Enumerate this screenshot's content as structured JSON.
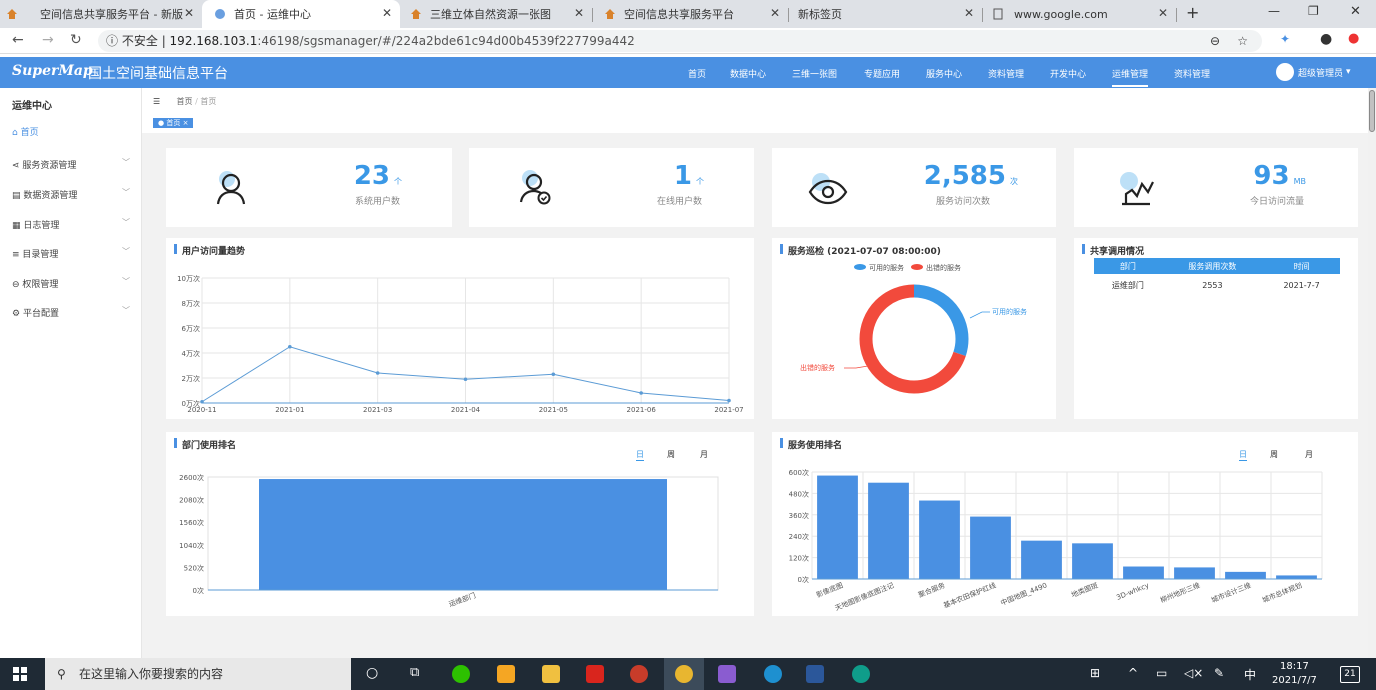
{
  "browser": {
    "tabs": [
      {
        "title": "空间信息共享服务平台 - 新版"
      },
      {
        "title": "首页 - 运维中心"
      },
      {
        "title": "三维立体自然资源一张图"
      },
      {
        "title": "空间信息共享服务平台"
      },
      {
        "title": "新标签页"
      },
      {
        "title": "www.google.com"
      }
    ],
    "new_tab": "+",
    "address": {
      "security": "不安全",
      "host": "192.168.103.1",
      "path": ":46198/sgsmanager/#/224a2bde61c94d00b4539f227799a442"
    }
  },
  "app": {
    "logo": "SuperMap",
    "title": "国土空间基础信息平台",
    "nav": [
      "首页",
      "数据中心",
      "三维一张图",
      "专题应用",
      "服务中心",
      "资料管理",
      "开发中心",
      "运维管理",
      "资料管理"
    ],
    "active_nav": "运维管理",
    "user": "超级管理员"
  },
  "sidebar": {
    "title": "运维中心",
    "home": "首页",
    "items": [
      "服务资源管理",
      "数据资源管理",
      "日志管理",
      "目录管理",
      "权限管理",
      "平台配置"
    ]
  },
  "breadcrumb": {
    "home": "首页",
    "sep": "/",
    "current": "首页"
  },
  "page_tab": "首页",
  "stats": [
    {
      "value": "23",
      "unit": "个",
      "label": "系统用户数",
      "icon": "user-icon"
    },
    {
      "value": "1",
      "unit": "个",
      "label": "在线用户数",
      "icon": "online-user-icon"
    },
    {
      "value": "2,585",
      "unit": "次",
      "label": "服务访问次数",
      "icon": "eye-icon"
    },
    {
      "value": "93",
      "unit": "MB",
      "label": "今日访问流量",
      "icon": "trend-icon"
    }
  ],
  "panels": {
    "visits": "用户访问量趋势",
    "inspection": "服务巡检 (2021-07-07 08:00:00)",
    "share": "共享调用情况",
    "dept": "部门使用排名",
    "service": "服务使用排名"
  },
  "periods": [
    "日",
    "周",
    "月"
  ],
  "share_table": {
    "headers": [
      "部门",
      "服务调用次数",
      "时间"
    ],
    "rows": [
      [
        "运维部门",
        "2553",
        "2021-7-7"
      ]
    ]
  },
  "chart_data": [
    {
      "type": "line",
      "title": "用户访问量趋势",
      "x": [
        "2020-11",
        "2021-01",
        "2021-03",
        "2021-04",
        "2021-05",
        "2021-06",
        "2021-07"
      ],
      "y_ticks": [
        "0万次",
        "2万次",
        "4万次",
        "6万次",
        "8万次",
        "10万次"
      ],
      "ylim": [
        0,
        10
      ],
      "values": [
        0.1,
        4.5,
        2.4,
        1.9,
        2.3,
        0.8,
        0.2
      ],
      "color": "#5b9bd5"
    },
    {
      "type": "pie",
      "title": "服务巡检 (2021-07-07 08:00:00)",
      "legend": [
        "可用的服务",
        "出错的服务"
      ],
      "values": [
        30,
        70
      ],
      "colors": [
        "#3a98e6",
        "#f24a3c"
      ],
      "labels": [
        "可用的服务",
        "出错的服务"
      ]
    },
    {
      "type": "bar",
      "title": "部门使用排名",
      "categories": [
        "运维部门"
      ],
      "values": [
        2553
      ],
      "y_ticks": [
        "0次",
        "520次",
        "1040次",
        "1560次",
        "2080次",
        "2600次"
      ],
      "ylim": [
        0,
        2600
      ],
      "color": "#4a90e2"
    },
    {
      "type": "bar",
      "title": "服务使用排名",
      "categories": [
        "影像底图",
        "天地图影像底图注记",
        "聚合服务",
        "基本农田保护红线",
        "中国地图_4490",
        "地类图斑",
        "3D-whkcy",
        "柳州地形三维",
        "城市设计三维",
        "城市总体规划"
      ],
      "values": [
        580,
        540,
        440,
        350,
        215,
        200,
        70,
        65,
        40,
        20
      ],
      "y_ticks": [
        "0次",
        "120次",
        "240次",
        "360次",
        "480次",
        "600次"
      ],
      "ylim": [
        0,
        600
      ],
      "color": "#4a90e2"
    }
  ],
  "taskbar": {
    "search": "在这里输入你要搜索的内容",
    "ime": "中",
    "time": "18:17",
    "date": "2021/7/7",
    "notif": "21"
  }
}
